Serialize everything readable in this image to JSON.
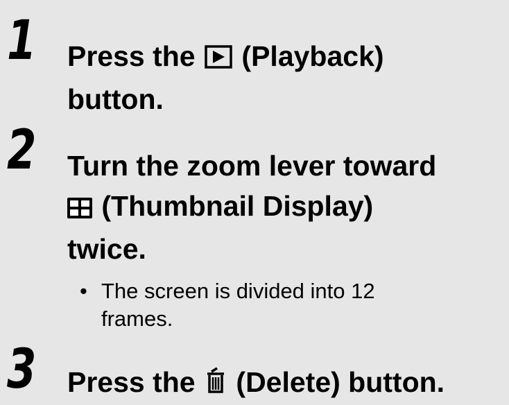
{
  "steps": [
    {
      "number": "1",
      "title_before_icon": "Press the",
      "icon": "playback-icon",
      "title_after_icon": "(Playback)",
      "title_line2": "button."
    },
    {
      "number": "2",
      "title_line1": "Turn the zoom lever toward",
      "icon": "thumbnail-display-icon",
      "title_after_icon": "(Thumbnail Display)",
      "title_line3": "twice."
    },
    {
      "number": "3",
      "title_before_icon": "Press the",
      "icon": "delete-icon",
      "title_after_icon": "(Delete) button."
    }
  ],
  "note": {
    "bullet": "•",
    "line1": "The screen is divided into 12",
    "line2": "frames."
  },
  "colors": {
    "background": "#e6e6e6",
    "text": "#000000"
  }
}
